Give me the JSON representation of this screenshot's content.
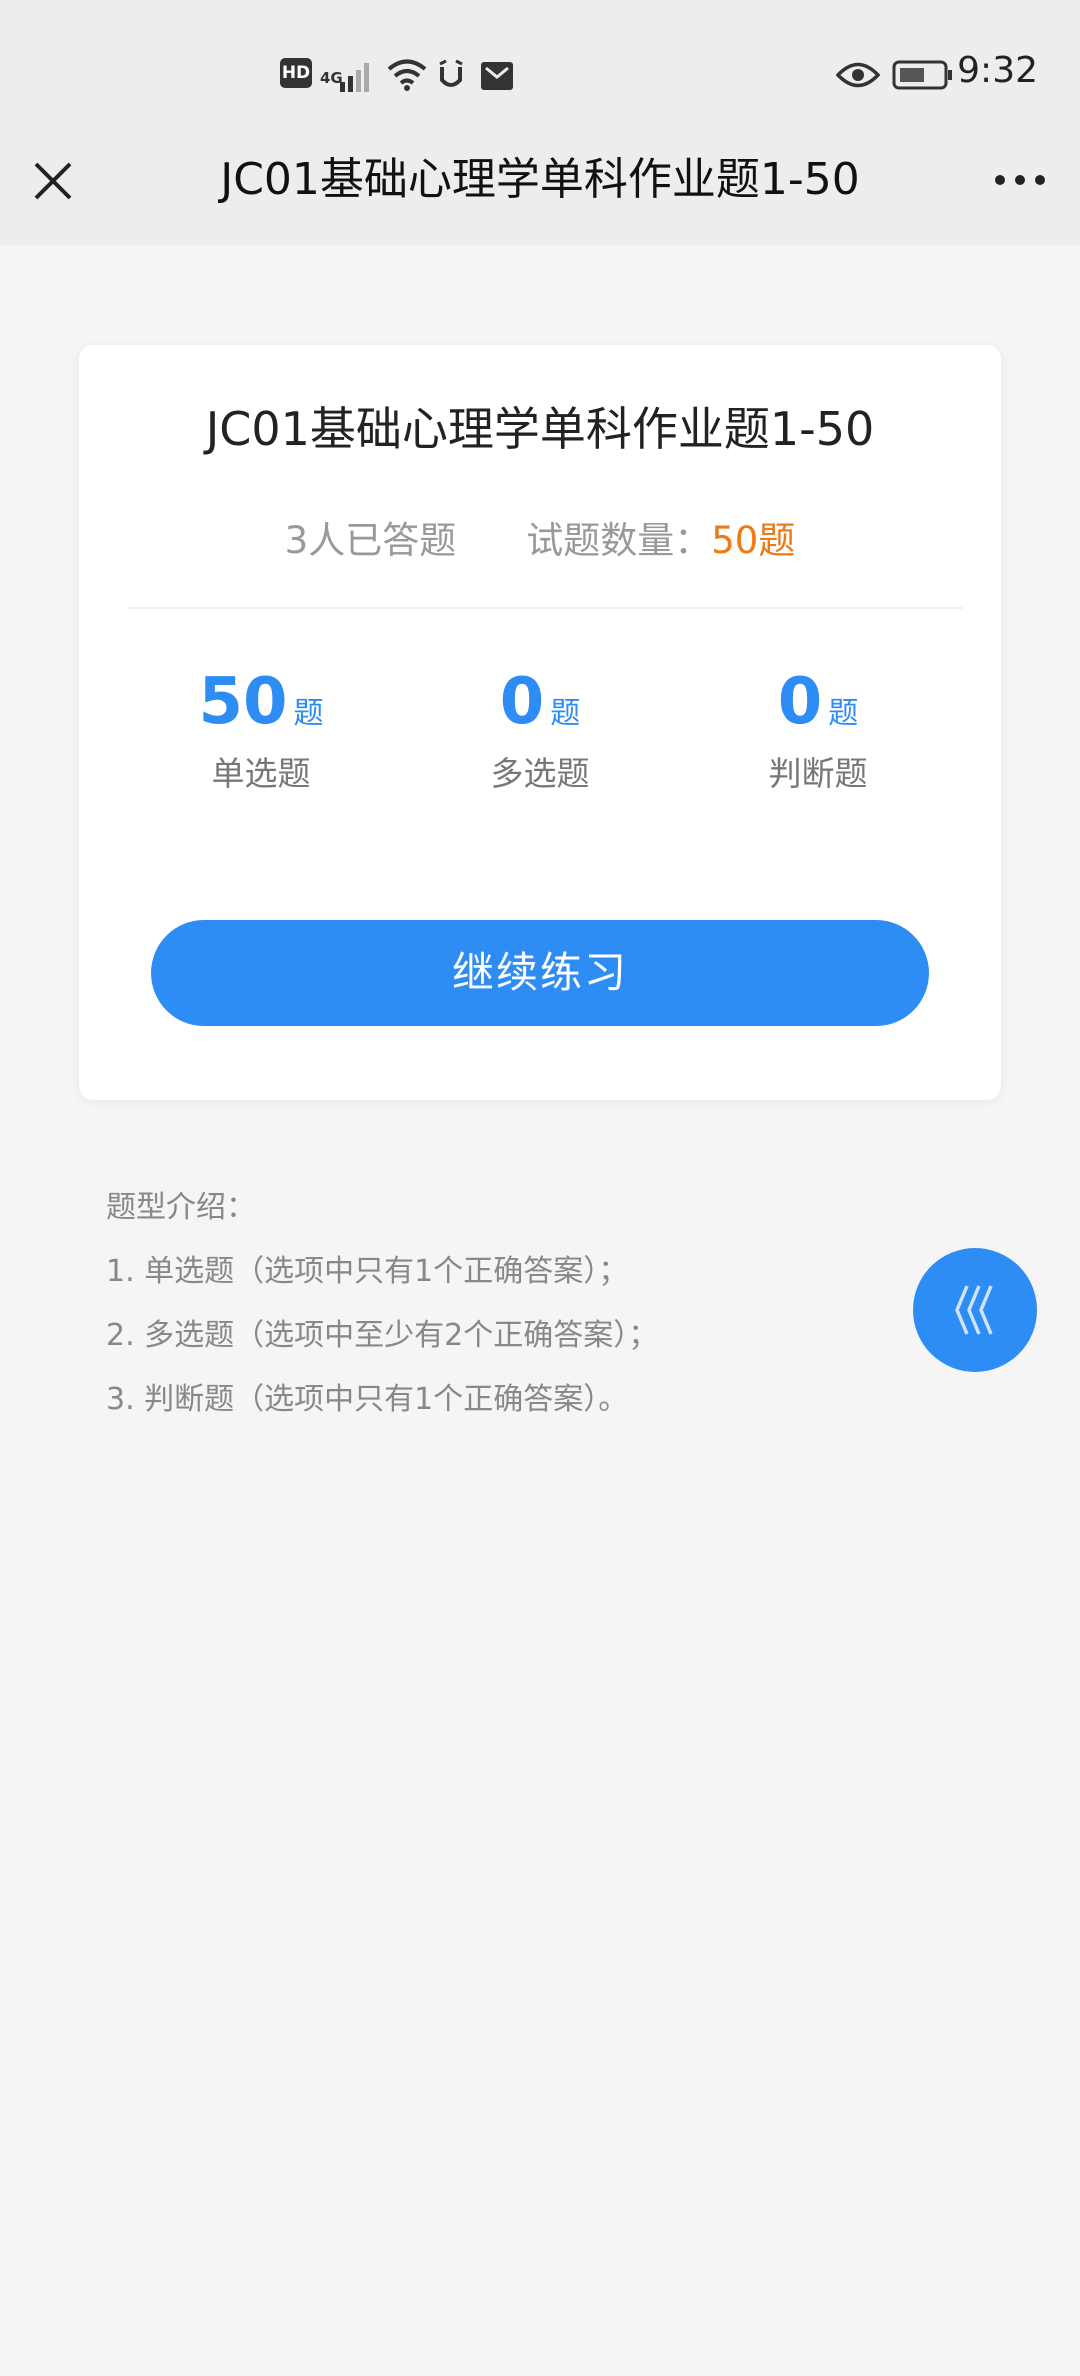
{
  "status_bar": {
    "hd_badge": "HD",
    "network": "4G",
    "time": "9:32",
    "icons": [
      "signal-icon",
      "wifi-icon",
      "alarm-icon",
      "notification-icon",
      "eye-icon",
      "battery-icon"
    ]
  },
  "header": {
    "title": "JC01基础心理学单科作业题1-50",
    "close_icon": "close-icon",
    "more_icon": "more-icon"
  },
  "card": {
    "title": "JC01基础心理学单科作业题1-50",
    "answered_text": "3人已答题",
    "count_label": "试题数量：",
    "count_value": "50题",
    "stats": [
      {
        "value": "50",
        "unit": "题",
        "label": "单选题"
      },
      {
        "value": "0",
        "unit": "题",
        "label": "多选题"
      },
      {
        "value": "0",
        "unit": "题",
        "label": "判断题"
      }
    ],
    "continue_label": "继续练习"
  },
  "intro": {
    "heading": "题型介绍：",
    "lines": [
      "1. 单选题（选项中只有1个正确答案）；",
      "2. 多选题（选项中至少有2个正确答案）；",
      "3. 判断题（选项中只有1个正确答案）。"
    ]
  },
  "floating_button": {
    "icon": "chevrons-left-icon"
  },
  "colors": {
    "accent": "#2e8cf5",
    "count_orange": "#ee7a16",
    "background": "#f5f5f5"
  }
}
